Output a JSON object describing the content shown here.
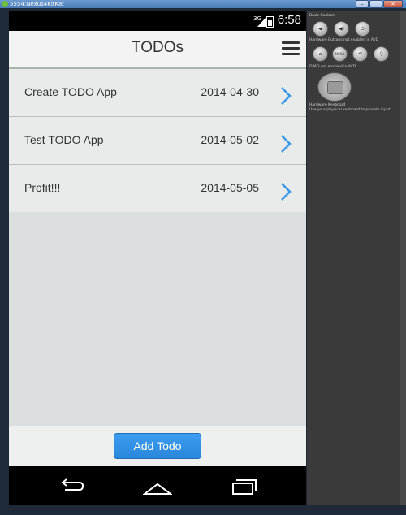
{
  "window": {
    "title": "5554:Nexus4KitKat"
  },
  "status_bar": {
    "network": "3G",
    "time": "6:58"
  },
  "header": {
    "title": "TODOs",
    "menu_icon": "menu-icon"
  },
  "todos": [
    {
      "name": "Create TODO App",
      "date": "2014-04-30"
    },
    {
      "name": "Test TODO App",
      "date": "2014-05-02"
    },
    {
      "name": "Profit!!!",
      "date": "2014-05-05"
    }
  ],
  "footer": {
    "add_label": "Add Todo"
  },
  "nav": {
    "back": "back-icon",
    "home": "home-icon",
    "recents": "recents-icon"
  },
  "panel": {
    "basic_controls": "Basic Controls",
    "hardware_buttons": "Hardware Buttons not enabled in AVD",
    "dpad": "DPAD not enabled in AVD",
    "hardware_keyboard": "Hardware Keyboard",
    "keyboard_hint": "Use your physical keyboard to provide input",
    "menu_label": "MENU"
  },
  "colors": {
    "accent": "#2a87db",
    "chevron": "#3a97e6"
  }
}
